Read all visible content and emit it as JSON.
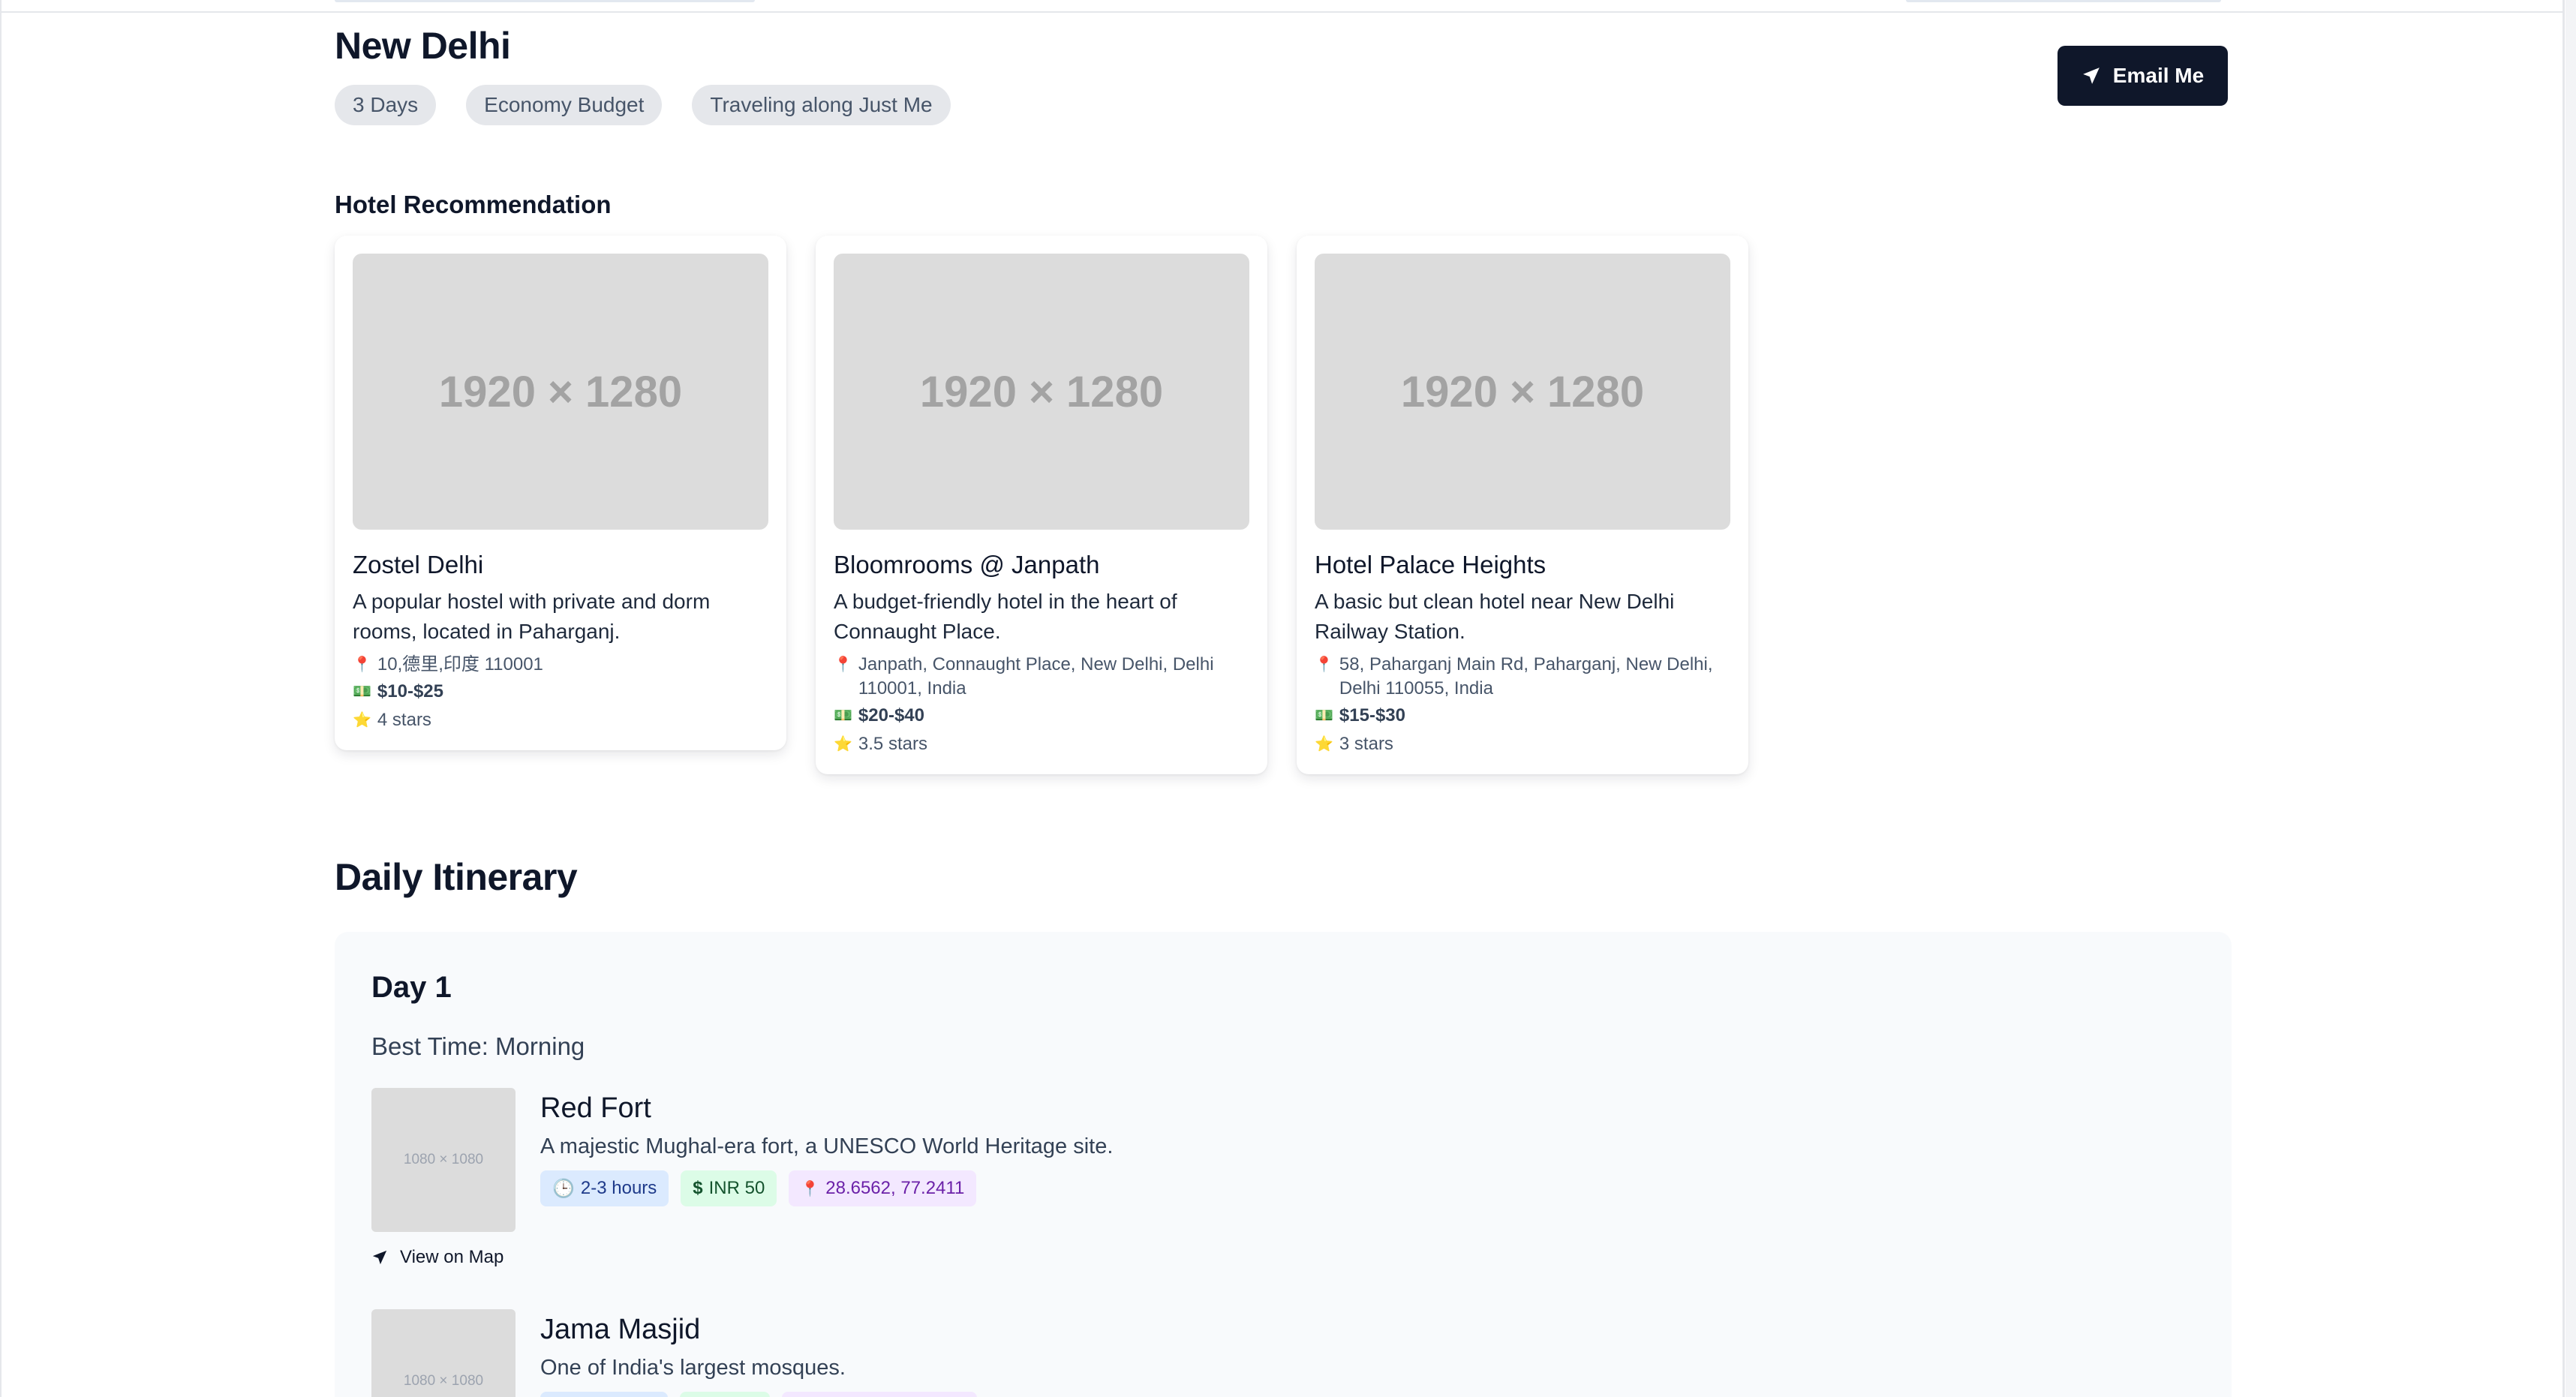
{
  "trip": {
    "city": "New Delhi",
    "badges": [
      "3 Days",
      "Economy Budget",
      "Traveling along Just Me"
    ],
    "email_button": "Email Me"
  },
  "hotels": {
    "heading": "Hotel Recommendation",
    "items": [
      {
        "image_placeholder": "1920 × 1280",
        "name": "Zostel Delhi",
        "description": "A popular hostel with private and dorm rooms, located in Paharganj.",
        "address": "10,德里,印度 110001",
        "price": "$10-$25",
        "rating": "4 stars"
      },
      {
        "image_placeholder": "1920 × 1280",
        "name": "Bloomrooms @ Janpath",
        "description": "A budget-friendly hotel in the heart of Connaught Place.",
        "address": "Janpath, Connaught Place, New Delhi, Delhi 110001, India",
        "price": "$20-$40",
        "rating": "3.5 stars"
      },
      {
        "image_placeholder": "1920 × 1280",
        "name": "Hotel Palace Heights",
        "description": "A basic but clean hotel near New Delhi Railway Station.",
        "address": "58, Paharganj Main Rd, Paharganj, New Delhi, Delhi 110055, India",
        "price": "$15-$30",
        "rating": "3 stars"
      }
    ]
  },
  "itinerary": {
    "heading": "Daily Itinerary",
    "day": {
      "title": "Day 1",
      "best_time": "Best Time: Morning",
      "view_on_map": "View on Map",
      "places": [
        {
          "image_placeholder": "1080 × 1080",
          "name": "Red Fort",
          "description": "A majestic Mughal-era fort, a UNESCO World Heritage site.",
          "duration": "2-3 hours",
          "fee": "INR 50",
          "coordinates": "28.6562, 77.2411"
        },
        {
          "image_placeholder": "1080 × 1080",
          "name": "Jama Masjid",
          "description": "One of India's largest mosques."
        }
      ]
    }
  },
  "icons": {
    "location": "pin-icon",
    "price": "banknote-icon",
    "rating": "star-icon",
    "send": "send-icon",
    "clock": "clock-icon",
    "dollar": "dollar-icon"
  },
  "colors": {
    "primary_button": "#0f172a",
    "badge_bg": "#e5e7eb",
    "chip_blue": "#dbeafe",
    "chip_green": "#dcfce7",
    "chip_purple": "#f3e8ff"
  }
}
